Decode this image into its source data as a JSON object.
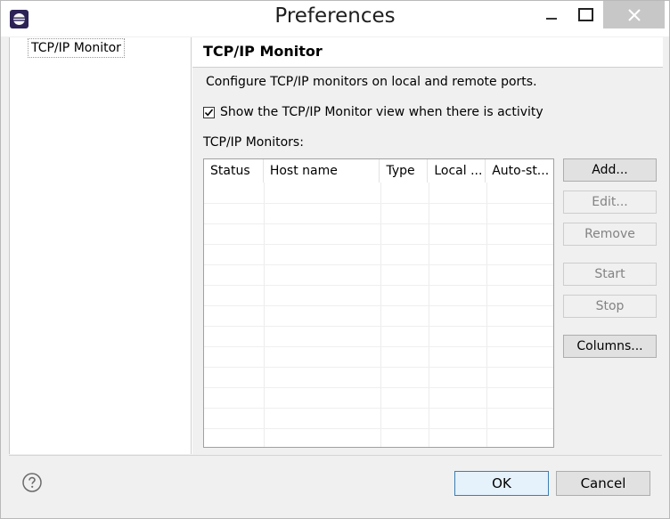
{
  "window": {
    "title": "Preferences",
    "accent_color": "#3c7fb1"
  },
  "sidebar": {
    "items": [
      {
        "label": "TCP/IP Monitor",
        "selected": true
      }
    ]
  },
  "pane": {
    "title": "TCP/IP Monitor",
    "description": "Configure TCP/IP monitors on local and remote ports.",
    "show_view_checkbox": {
      "label": "Show the TCP/IP Monitor view when there is activity",
      "checked": true
    },
    "monitors_label": "TCP/IP Monitors:",
    "table": {
      "columns": [
        "Status",
        "Host name",
        "Type",
        "Local ...",
        "Auto-st..."
      ],
      "rows": []
    },
    "buttons": {
      "add": "Add...",
      "edit": "Edit...",
      "remove": "Remove",
      "start": "Start",
      "stop": "Stop",
      "columns": "Columns..."
    }
  },
  "footer": {
    "help_icon": "question-circle-icon",
    "ok": "OK",
    "cancel": "Cancel"
  }
}
